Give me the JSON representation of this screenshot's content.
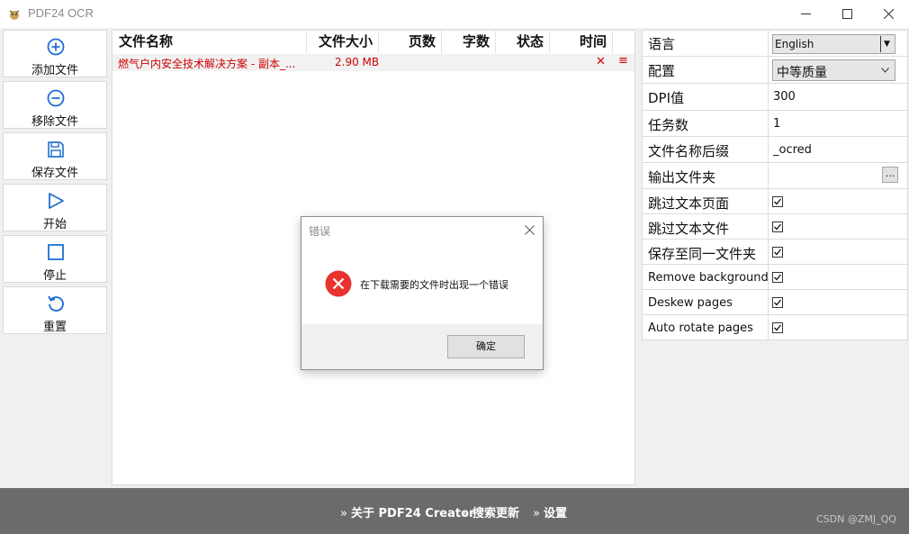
{
  "window": {
    "title": "PDF24 OCR"
  },
  "toolbar": {
    "buttons": [
      {
        "label": "添加文件",
        "icon": "plus-circle-icon"
      },
      {
        "label": "移除文件",
        "icon": "minus-circle-icon"
      },
      {
        "label": "保存文件",
        "icon": "floppy-disk-icon"
      },
      {
        "label": "开始",
        "icon": "play-icon"
      },
      {
        "label": "停止",
        "icon": "stop-icon"
      },
      {
        "label": "重置",
        "icon": "reset-icon"
      }
    ]
  },
  "file_list": {
    "columns": [
      "文件名称",
      "文件大小",
      "页数",
      "字数",
      "状态",
      "时间"
    ],
    "rows": [
      {
        "name": "燃气户内安全技术解决方案 - 副本_...",
        "size": "2.90 MB",
        "pages": "",
        "words": "",
        "status": "",
        "time": ""
      }
    ]
  },
  "settings": {
    "language": {
      "label": "语言",
      "value": "English"
    },
    "profile": {
      "label": "配置",
      "value": "中等质量"
    },
    "dpi": {
      "label": "DPI值",
      "value": "300"
    },
    "jobs": {
      "label": "任务数",
      "value": "1"
    },
    "suffix": {
      "label": "文件名称后缀",
      "value": "_ocred"
    },
    "output_folder": {
      "label": "输出文件夹",
      "button": "..."
    },
    "skip_text_pages": {
      "label": "跳过文本页面",
      "checked": true
    },
    "skip_text_files": {
      "label": "跳过文本文件",
      "checked": true
    },
    "save_same_folder": {
      "label": "保存至同一文件夹",
      "checked": true
    },
    "remove_background": {
      "label": "Remove background",
      "checked": true
    },
    "deskew_pages": {
      "label": "Deskew pages",
      "checked": true
    },
    "auto_rotate": {
      "label": "Auto rotate pages",
      "checked": true
    }
  },
  "dialog": {
    "title": "错误",
    "message": "在下载需要的文件时出现一个错误",
    "ok_label": "确定",
    "icon": "error-icon"
  },
  "footer": {
    "links": [
      "关于 PDF24 Creator",
      "搜索更新",
      "设置"
    ],
    "watermark": "CSDN @ZMJ_QQ"
  },
  "colors": {
    "accent_blue": "#1f6fd1",
    "error_red": "#cc0000",
    "footer_bg": "#6b6b6b"
  }
}
